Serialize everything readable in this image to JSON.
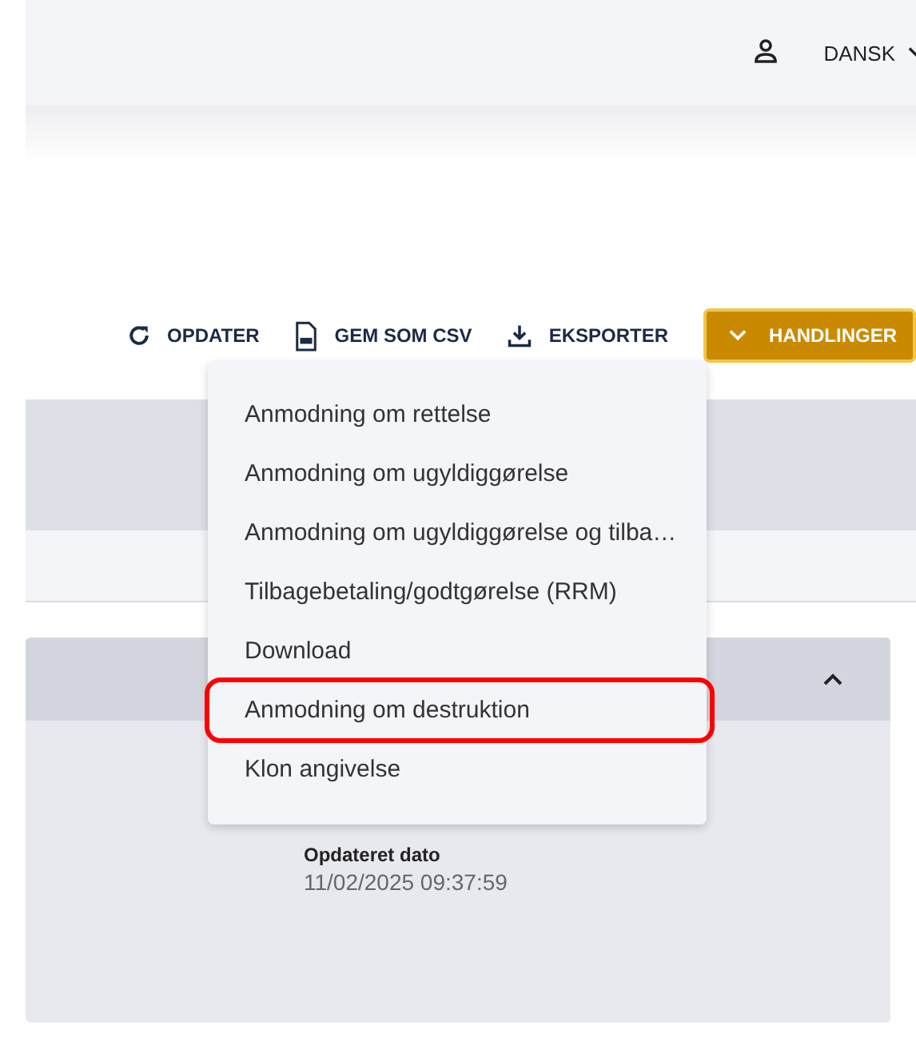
{
  "header": {
    "language": "DANSK"
  },
  "toolbar": [
    {
      "kind": "refresh",
      "label": "OPDATER"
    },
    {
      "kind": "csv",
      "label": "GEM SOM CSV"
    },
    {
      "kind": "export",
      "label": "EKSPORTER"
    },
    {
      "kind": "actions",
      "label": "HANDLINGER"
    }
  ],
  "actions_menu": {
    "items": [
      {
        "label": "Anmodning om rettelse",
        "highlighted": false
      },
      {
        "label": "Anmodning om ugyldiggørelse",
        "highlighted": false
      },
      {
        "label": "Anmodning om ugyldiggørelse og tilba…",
        "highlighted": false
      },
      {
        "label": "Tilbagebetaling/godtgørelse (RRM)",
        "highlighted": false
      },
      {
        "label": "Download",
        "highlighted": false
      },
      {
        "label": "Anmodning om destruktion",
        "highlighted": true
      },
      {
        "label": "Klon angivelse",
        "highlighted": false
      }
    ]
  },
  "card": {
    "expanded": true,
    "fields": [
      {
        "label": "Opdateret dato",
        "value": "11/02/2025 09:37:59"
      }
    ]
  }
}
